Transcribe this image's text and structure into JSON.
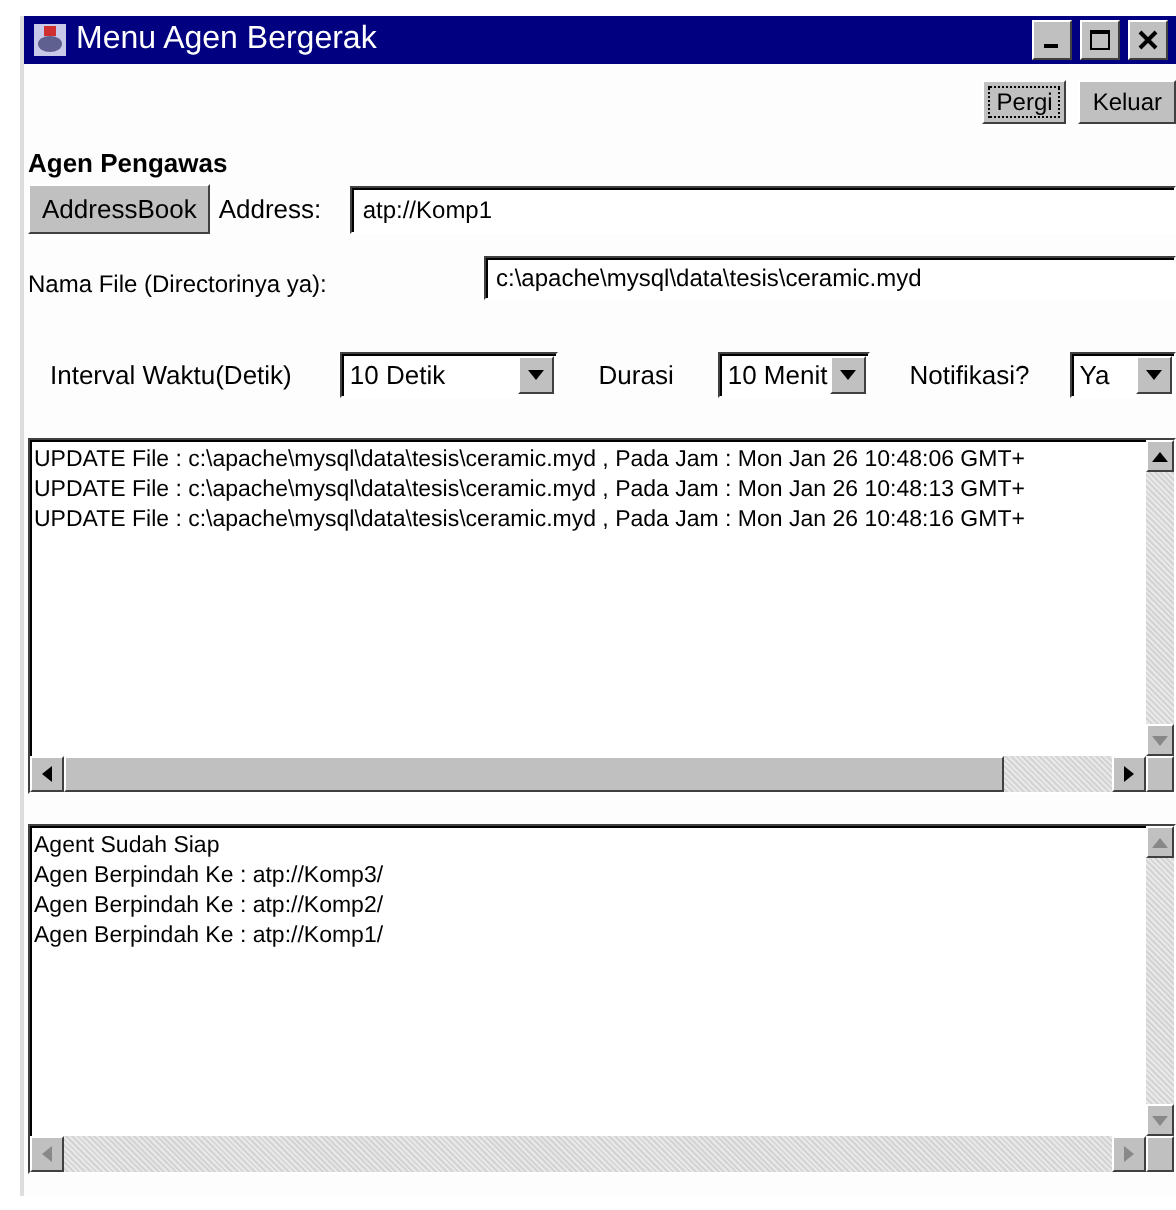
{
  "window": {
    "title": "Menu Agen Bergerak"
  },
  "top_buttons": [
    {
      "label": "Pergi",
      "focused": true
    },
    {
      "label": "Keluar",
      "focused": false
    }
  ],
  "section_title": "Agen Pengawas",
  "address": {
    "button": "AddressBook",
    "label": "Address:",
    "value": "atp://Komp1"
  },
  "file": {
    "label": "Nama File (Directorinya ya):",
    "value": "c:\\apache\\mysql\\data\\tesis\\ceramic.myd"
  },
  "options": [
    {
      "label": "Interval Waktu(Detik)",
      "value": "10 Detik"
    },
    {
      "label": "Durasi",
      "value": "10 Menit"
    },
    {
      "label": "Notifikasi?",
      "value": "Ya"
    }
  ],
  "update_log": [
    "UPDATE File : c:\\apache\\mysql\\data\\tesis\\ceramic.myd , Pada Jam : Mon Jan 26 10:48:06 GMT+",
    "UPDATE File : c:\\apache\\mysql\\data\\tesis\\ceramic.myd , Pada Jam : Mon Jan 26 10:48:13 GMT+",
    "UPDATE File : c:\\apache\\mysql\\data\\tesis\\ceramic.myd , Pada Jam : Mon Jan 26 10:48:16 GMT+"
  ],
  "agent_log": [
    "Agent Sudah Siap",
    "Agen Berpindah Ke : atp://Komp3/",
    "Agen Berpindah Ke : atp://Komp2/",
    "Agen Berpindah Ke : atp://Komp1/"
  ]
}
